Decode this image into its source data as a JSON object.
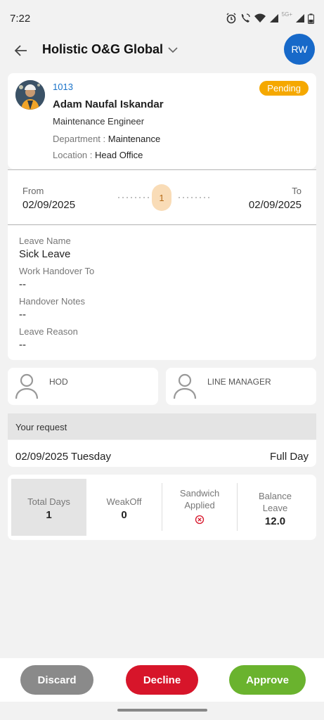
{
  "status_bar": {
    "time": "7:22",
    "network_label": "5G+"
  },
  "header": {
    "org_name": "Holistic O&G Global",
    "user_initials": "RW"
  },
  "employee": {
    "id": "1013",
    "name": "Adam Naufal Iskandar",
    "designation": "Maintenance Engineer",
    "department_label": "Department : ",
    "department": "Maintenance",
    "location_label": "Location : ",
    "location": "Head Office",
    "status": "Pending"
  },
  "dates": {
    "from_label": "From",
    "from": "02/09/2025",
    "to_label": "To",
    "to": "02/09/2025",
    "days": "1"
  },
  "leave": {
    "name_label": "Leave Name",
    "name": "Sick Leave",
    "handover_label": "Work Handover To",
    "handover": "--",
    "notes_label": "Handover Notes",
    "notes": "--",
    "reason_label": "Leave Reason",
    "reason": "--"
  },
  "approvers": [
    {
      "role": "HOD"
    },
    {
      "role": "LINE MANAGER"
    }
  ],
  "request": {
    "header": "Your request",
    "date": "02/09/2025 Tuesday",
    "type": "Full Day"
  },
  "summary": {
    "total_days_label": "Total Days",
    "total_days": "1",
    "weekoff_label": "WeakOff",
    "weekoff": "0",
    "sandwich_label": "Sandwich Applied",
    "balance_label": "Balance Leave",
    "balance": "12.0"
  },
  "actions": {
    "discard": "Discard",
    "decline": "Decline",
    "approve": "Approve"
  },
  "colors": {
    "accent": "#1769c9",
    "pending": "#f5a800",
    "discard": "#8a8a8a",
    "decline": "#d7152a",
    "approve": "#6ab32e"
  }
}
